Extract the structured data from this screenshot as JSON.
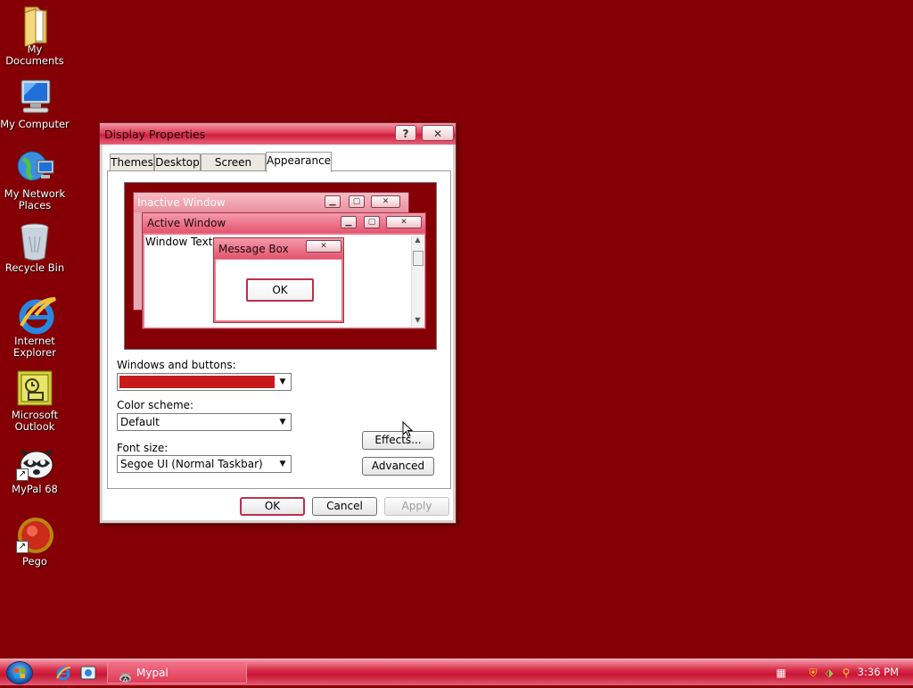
{
  "desktop": {
    "icons": [
      {
        "label": "My Documents",
        "icon": "folder-icon"
      },
      {
        "label": "My Computer",
        "icon": "computer-icon"
      },
      {
        "label": "My Network Places",
        "icon": "network-icon"
      },
      {
        "label": "Recycle Bin",
        "icon": "recycle-bin-icon"
      },
      {
        "label": "Internet Explorer",
        "icon": "ie-icon"
      },
      {
        "label": "Microsoft Outlook",
        "icon": "outlook-icon"
      },
      {
        "label": "MyPal 68",
        "icon": "raccoon-icon"
      },
      {
        "label": "Pego",
        "icon": "pego-icon"
      }
    ]
  },
  "dialog": {
    "title": "Display Properties",
    "help_glyph": "?",
    "close_glyph": "✕",
    "tabs": [
      {
        "label": "Themes"
      },
      {
        "label": "Desktop"
      },
      {
        "label": "Screen Saver"
      },
      {
        "label": "Appearance",
        "active": true
      }
    ],
    "preview": {
      "inactive_title": "Inactive Window",
      "active_title": "Active Window",
      "window_text": "Window Text",
      "message_title": "Message Box",
      "message_ok": "OK"
    },
    "windows_buttons_label": "Windows and buttons:",
    "windows_buttons_color": "#c81a1a",
    "color_scheme_label": "Color scheme:",
    "color_scheme_value": "Default",
    "font_size_label": "Font size:",
    "font_size_value": "Segoe UI (Normal Taskbar)",
    "effects_label": "Effects...",
    "advanced_label": "Advanced",
    "ok_label": "OK",
    "cancel_label": "Cancel",
    "apply_label": "Apply"
  },
  "taskbar": {
    "task_label": "Mypal",
    "clock": "3:36 PM"
  },
  "colors": {
    "desktop": "#850005",
    "accent": "#d82c48"
  }
}
